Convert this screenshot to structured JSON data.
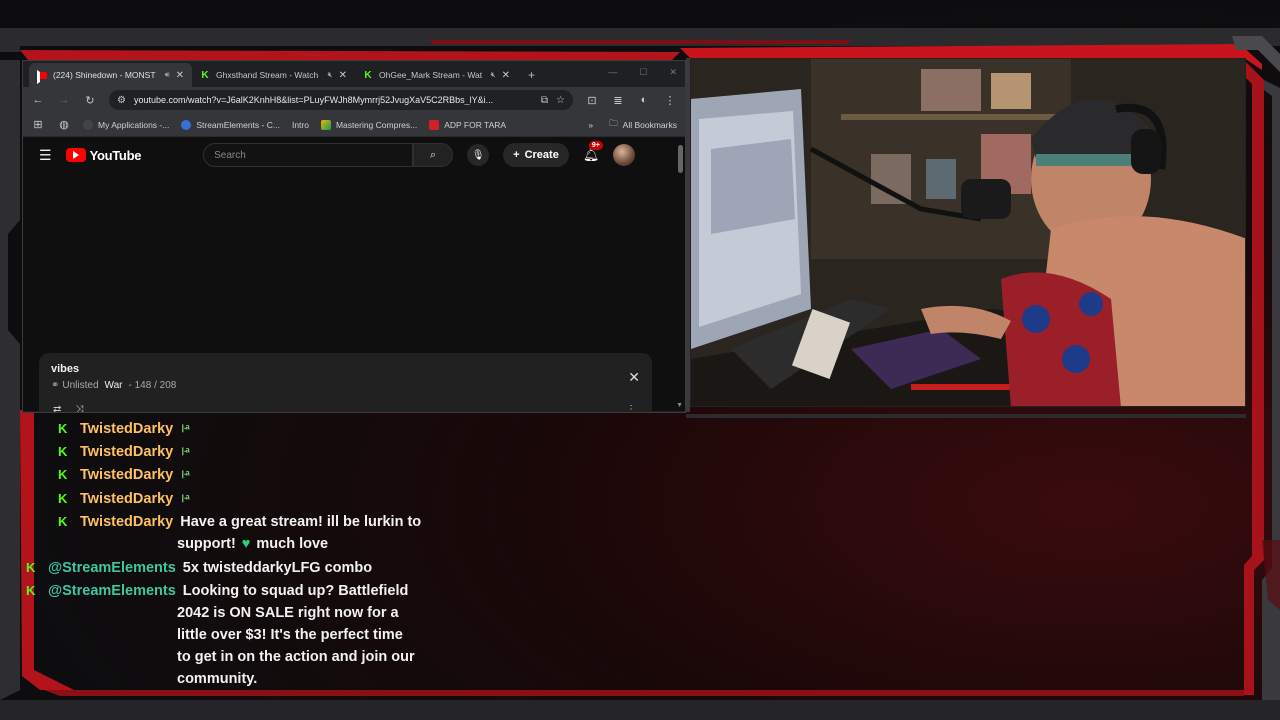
{
  "browser": {
    "tabs": [
      {
        "title": "(224) Shinedown - MONST",
        "favicon": "youtube",
        "active": true
      },
      {
        "title": "Ghxsthand Stream - Watch",
        "favicon": "kick",
        "active": false
      },
      {
        "title": "OhGee_Mark Stream - Wat",
        "favicon": "kick",
        "active": false
      }
    ],
    "url": "youtube.com/watch?v=J6alK2KnhH8&list=PLuyFWJh8Mymrrj52JvugXaV5C2RBbs_lY&i...",
    "bookmarks": [
      "My Applications -...",
      "StreamElements - C...",
      "Intro",
      "Mastering Compres...",
      "ADP FOR TARA"
    ],
    "all_bookmarks": "All Bookmarks"
  },
  "youtube": {
    "logo_text": "YouTube",
    "search_placeholder": "Search",
    "create_label": "Create",
    "notif_badge": "9+",
    "playlist": {
      "title": "vibes",
      "visibility": "Unlisted",
      "channel": "War",
      "position": "- 148 / 208"
    }
  },
  "chat": {
    "messages": [
      {
        "user": "TwistedDarky",
        "text": "",
        "emote": "꜏ᵃ"
      },
      {
        "user": "TwistedDarky",
        "text": "",
        "emote": "꜏ᵃ"
      },
      {
        "user": "TwistedDarky",
        "text": "",
        "emote": "꜏ᵃ"
      },
      {
        "user": "TwistedDarky",
        "text": "",
        "emote": "꜏ᵃ"
      },
      {
        "user": "TwistedDarky",
        "text_line1": "Have a great stream! ill be lurkin to",
        "text_line2a": "support!",
        "text_line2b": "much love"
      },
      {
        "user": "@StreamElements",
        "text": "5x twisteddarkyLFG combo"
      },
      {
        "user": "@StreamElements",
        "lines": [
          "Looking to squad up? Battlefield",
          "2042 is ON SALE right now for a",
          "little over $3! It's the perfect time",
          "to get in on the action and join our",
          "community."
        ]
      }
    ]
  },
  "colors": {
    "accent_red": "#c8141c",
    "kick_green": "#53fc18",
    "twisted_name": "#ffc062",
    "streamelements_name": "#3ec79b"
  }
}
